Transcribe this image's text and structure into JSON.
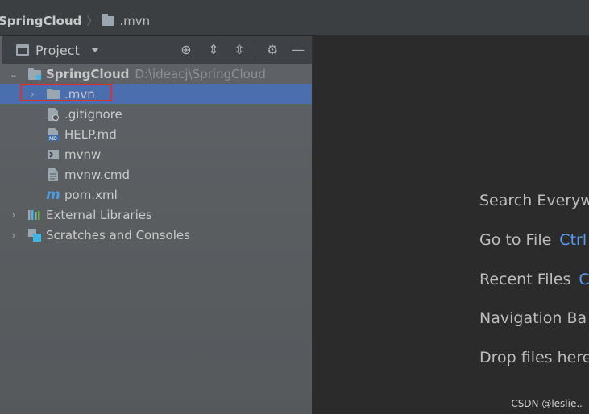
{
  "breadcrumb": {
    "project": "SpringCloud",
    "folder": ".mvn"
  },
  "panel": {
    "title": "Project"
  },
  "tree": {
    "root": {
      "name": "SpringCloud",
      "path": "D:\\ideacj\\SpringCloud"
    },
    "items": [
      {
        "label": ".mvn",
        "icon": "folder-icon"
      },
      {
        "label": ".gitignore",
        "icon": "gitignore-file-icon"
      },
      {
        "label": "HELP.md",
        "icon": "markdown-file-icon"
      },
      {
        "label": "mvnw",
        "icon": "shell-script-icon"
      },
      {
        "label": "mvnw.cmd",
        "icon": "text-file-icon"
      },
      {
        "label": "pom.xml",
        "icon": "maven-icon"
      }
    ],
    "external": "External Libraries",
    "scratches": "Scratches and Consoles"
  },
  "editor": {
    "hints": [
      {
        "label": "Search Everyw",
        "key": ""
      },
      {
        "label": "Go to File",
        "key": "Ctrl"
      },
      {
        "label": "Recent Files",
        "key": "Ct"
      },
      {
        "label": "Navigation Ba",
        "key": ""
      },
      {
        "label": "Drop files here",
        "key": ""
      }
    ]
  },
  "watermark": "CSDN @leslie..",
  "colors": {
    "selection": "#4b6eaf",
    "shortcut": "#589df6",
    "highlight_box": "#e0302b"
  }
}
